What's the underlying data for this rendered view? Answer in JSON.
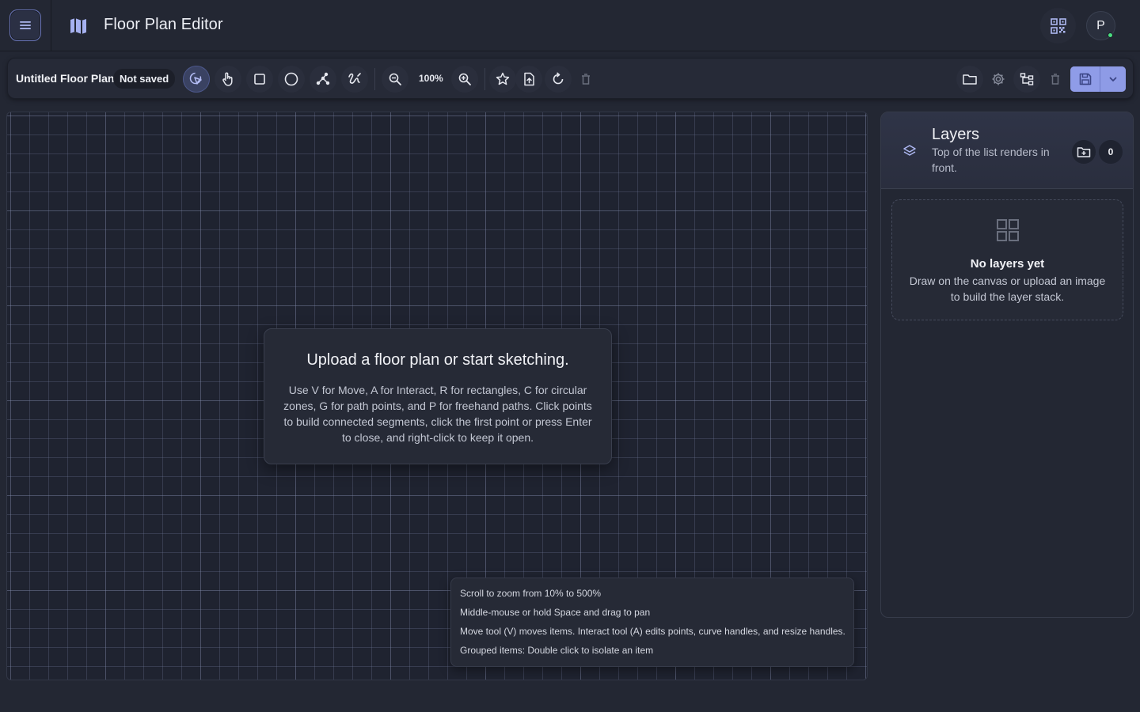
{
  "header": {
    "menu_icon": "hamburger-menu-icon",
    "app_icon": "map-icon",
    "title": "Floor Plan Editor",
    "qr_icon": "qr-code-icon",
    "avatar_initial": "P",
    "avatar_status_color": "#4ade80"
  },
  "toolbar": {
    "document_title": "Untitled Floor Plan",
    "save_status": "Not saved",
    "tools": [
      {
        "name": "move",
        "icon": "cursor-click-icon",
        "active": true
      },
      {
        "name": "interact",
        "icon": "hand-pointer-icon",
        "active": false
      },
      {
        "name": "rectangle",
        "icon": "square-icon",
        "active": false
      },
      {
        "name": "circle",
        "icon": "circle-icon",
        "active": false
      },
      {
        "name": "path",
        "icon": "path-points-icon",
        "active": false
      },
      {
        "name": "freehand",
        "icon": "freehand-icon",
        "active": false
      }
    ],
    "zoom_out_icon": "zoom-out-icon",
    "zoom_level": "100%",
    "zoom_in_icon": "zoom-in-icon",
    "right_icons": [
      "folder-icon",
      "settings-icon",
      "hierarchy-icon",
      "trash-icon"
    ],
    "save_icon": "save-icon",
    "save_dropdown_icon": "chevron-down-icon",
    "accent_color": "#8f9ce8"
  },
  "canvas": {
    "empty_title": "Upload a floor plan or start sketching.",
    "empty_body": "Use V for Move, A for Interact, R for rectangles, C for circular zones, G for path points, and P for freehand paths. Click points to build connected segments, click the first point or press Enter to close, and right-click to keep it open.",
    "hints": [
      "Scroll to zoom from 10% to 500%",
      "Middle-mouse or hold Space and drag to pan",
      "Move tool (V) moves items. Interact tool (A) edits points, curve handles, and resize handles.",
      "Grouped items: Double click to isolate an item"
    ]
  },
  "layers": {
    "title": "Layers",
    "subtitle": "Top of the list renders in front.",
    "count": "0",
    "empty_title": "No layers yet",
    "empty_body": "Draw on the canvas or upload an image to build the layer stack."
  }
}
